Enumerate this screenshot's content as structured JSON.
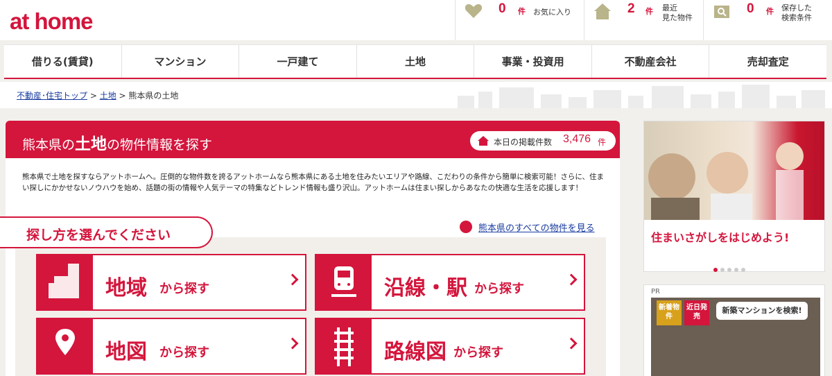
{
  "header": {
    "logo": "at home",
    "favorites": {
      "count": "0",
      "unit": "件",
      "label": "お気に入り"
    },
    "recent": {
      "count": "2",
      "unit": "件",
      "label_line1": "最近",
      "label_line2": "見た物件"
    },
    "saved": {
      "count": "0",
      "unit": "件",
      "label_line1": "保存した",
      "label_line2": "検索条件"
    }
  },
  "gnav": [
    "借りる(賃貸)",
    "マンション",
    "一戸建て",
    "土地",
    "事業・投資用",
    "不動産会社",
    "売却査定"
  ],
  "breadcrumb": {
    "home": "不動産･住宅トップ",
    "sep1": " > ",
    "land": "土地",
    "sep2": " > ",
    "current": "熊本県の土地"
  },
  "main": {
    "title_pre": "熊本県の",
    "title_bold": "土地",
    "title_post": "の物件情報を探す",
    "badge_label": "本日の掲載件数",
    "badge_count": "3,476",
    "badge_unit": "件",
    "description": "熊本県で土地を探すならアットホームへ。圧倒的な物件数を誇るアットホームなら熊本県にある土地を住みたいエリアや路線、こだわりの条件から簡単に検索可能！さらに、住まい探しにかかせないノウハウを始め、話題の街の情報や人気テーマの特集などトレンド情報も盛り沢山。アットホームは住まい探しからあなたの快適な生活を応援します！",
    "choose_label": "探し方を選んでください",
    "all_link": "熊本県のすべての物件を見る",
    "buttons": [
      {
        "big": "地域",
        "small": "から探す"
      },
      {
        "big": "沿線・駅",
        "small": "から探す"
      },
      {
        "big": "地図",
        "small": "から探す"
      },
      {
        "big": "路線図",
        "small": "から探す"
      }
    ]
  },
  "ads": {
    "banner_text": "住まいさがしをはじめよう!",
    "pr_label": "PR",
    "tag1": "新着物件",
    "tag2": "近日発売",
    "bubble": "新築マンションを検索!"
  },
  "colors": {
    "brand": "#d4153c",
    "link": "#1a3ca0"
  }
}
